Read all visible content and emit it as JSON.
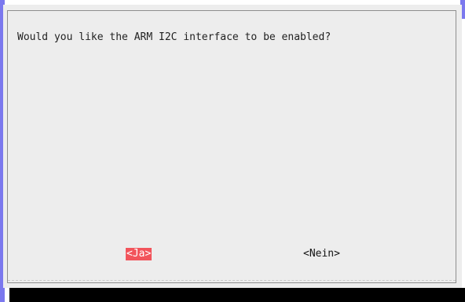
{
  "dialog": {
    "question": "Would you like the ARM I2C interface to be enabled?",
    "buttons": {
      "yes_label": "<Ja>",
      "no_label": "<Nein>"
    },
    "selected": "yes"
  },
  "colors": {
    "dialog_bg": "#ededed",
    "frame_border": "#8e8e8e",
    "selected_button_bg": "#f2545b",
    "selected_button_fg": "#ffffff",
    "accent": "#7b78ee",
    "shadow": "#000000"
  }
}
